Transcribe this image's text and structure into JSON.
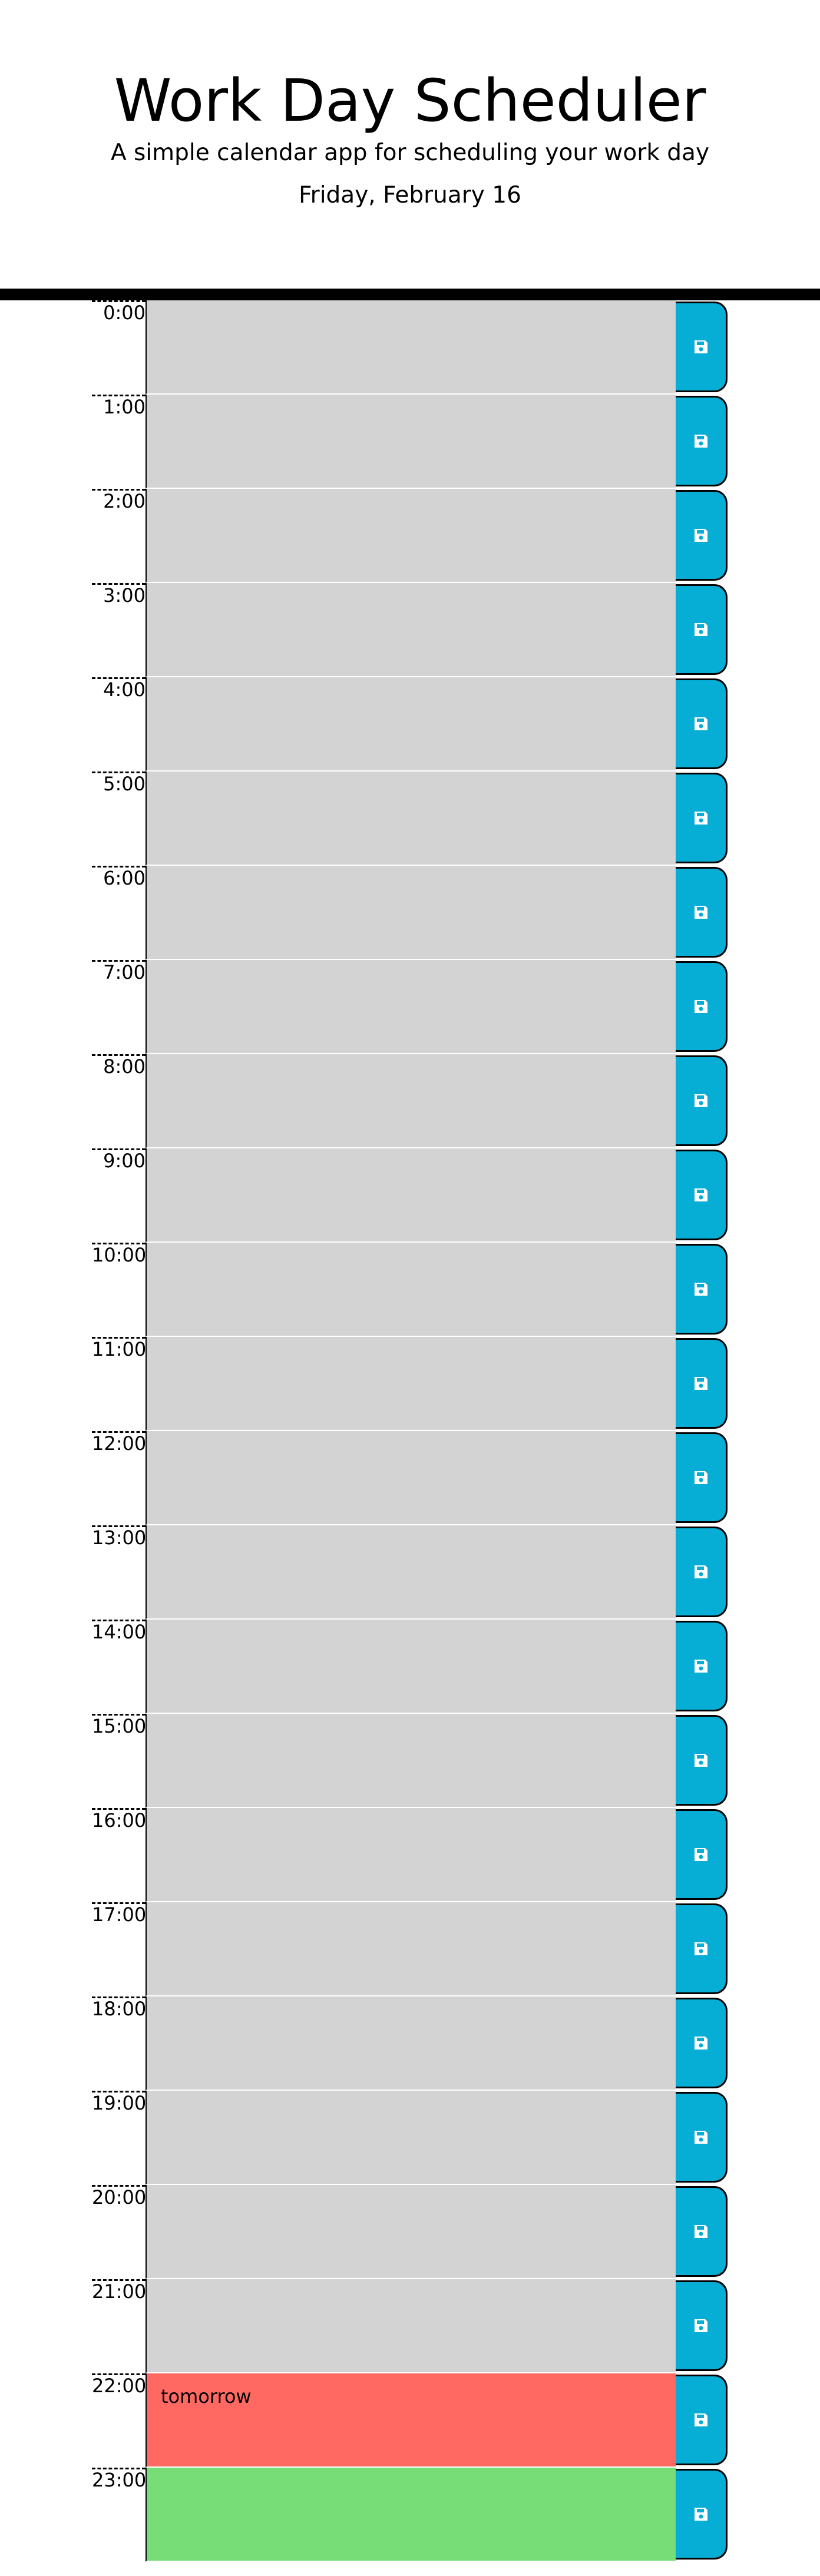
{
  "header": {
    "title": "Work Day Scheduler",
    "subtitle": "A simple calendar app for scheduling your work day",
    "current_day": "Friday, February 16"
  },
  "colors": {
    "past": "#d3d3d3",
    "present": "#ff6961",
    "future": "#77dd77",
    "save_button": "#06aed5"
  },
  "save_icon": "floppy-disk-icon",
  "hours": [
    {
      "label": "0:00",
      "text": "",
      "state": "past"
    },
    {
      "label": "1:00",
      "text": "",
      "state": "past"
    },
    {
      "label": "2:00",
      "text": "",
      "state": "past"
    },
    {
      "label": "3:00",
      "text": "",
      "state": "past"
    },
    {
      "label": "4:00",
      "text": "",
      "state": "past"
    },
    {
      "label": "5:00",
      "text": "",
      "state": "past"
    },
    {
      "label": "6:00",
      "text": "",
      "state": "past"
    },
    {
      "label": "7:00",
      "text": "",
      "state": "past"
    },
    {
      "label": "8:00",
      "text": "",
      "state": "past"
    },
    {
      "label": "9:00",
      "text": "",
      "state": "past"
    },
    {
      "label": "10:00",
      "text": "",
      "state": "past"
    },
    {
      "label": "11:00",
      "text": "",
      "state": "past"
    },
    {
      "label": "12:00",
      "text": "",
      "state": "past"
    },
    {
      "label": "13:00",
      "text": "",
      "state": "past"
    },
    {
      "label": "14:00",
      "text": "",
      "state": "past"
    },
    {
      "label": "15:00",
      "text": "",
      "state": "past"
    },
    {
      "label": "16:00",
      "text": "",
      "state": "past"
    },
    {
      "label": "17:00",
      "text": "",
      "state": "past"
    },
    {
      "label": "18:00",
      "text": "",
      "state": "past"
    },
    {
      "label": "19:00",
      "text": "",
      "state": "past"
    },
    {
      "label": "20:00",
      "text": "",
      "state": "past"
    },
    {
      "label": "21:00",
      "text": "",
      "state": "past"
    },
    {
      "label": "22:00",
      "text": "tomorrow",
      "state": "present"
    },
    {
      "label": "23:00",
      "text": "",
      "state": "future"
    }
  ]
}
